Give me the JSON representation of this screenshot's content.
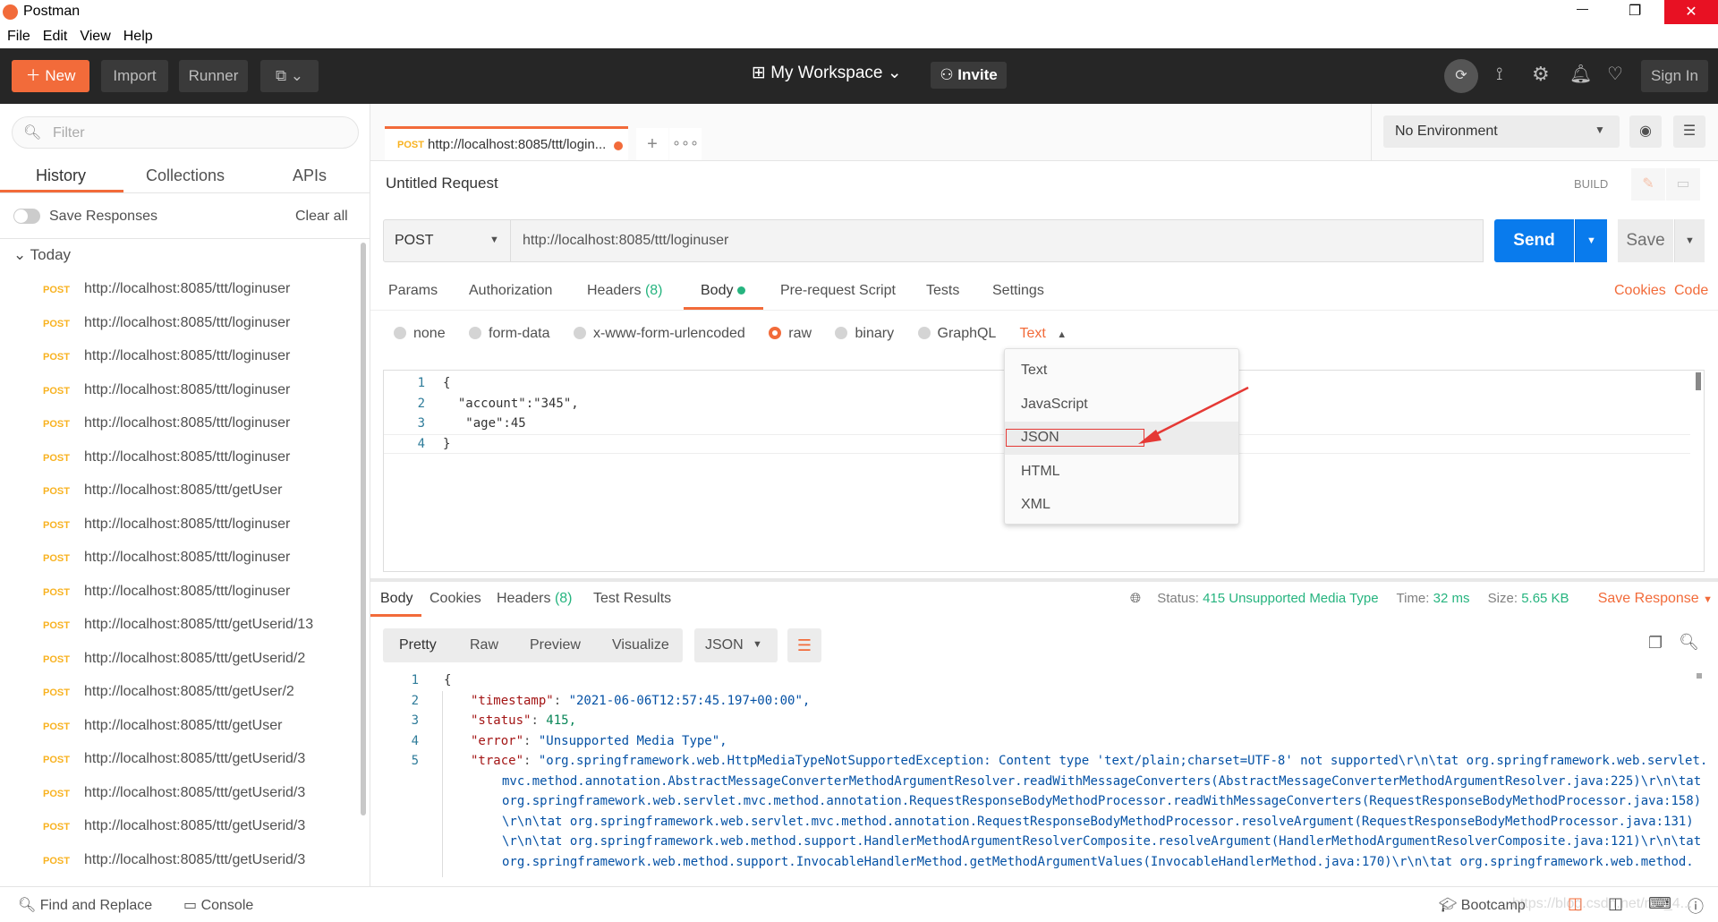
{
  "window": {
    "title": "Postman",
    "minimize": "—",
    "restore": "❐",
    "close": "✕"
  },
  "menu": [
    "File",
    "Edit",
    "View",
    "Help"
  ],
  "toolbar": {
    "new": "New",
    "import": "Import",
    "runner": "Runner",
    "workspace": "My Workspace",
    "invite": "Invite",
    "sign_in": "Sign In",
    "accent": "#f26b3a"
  },
  "sidebar": {
    "filter_placeholder": "Filter",
    "tabs": [
      "History",
      "Collections",
      "APIs"
    ],
    "save_responses": "Save Responses",
    "clear_all": "Clear all",
    "group": "Today",
    "items": [
      {
        "method": "POST",
        "url": "http://localhost:8085/ttt/loginuser"
      },
      {
        "method": "POST",
        "url": "http://localhost:8085/ttt/loginuser"
      },
      {
        "method": "POST",
        "url": "http://localhost:8085/ttt/loginuser"
      },
      {
        "method": "POST",
        "url": "http://localhost:8085/ttt/loginuser"
      },
      {
        "method": "POST",
        "url": "http://localhost:8085/ttt/loginuser"
      },
      {
        "method": "POST",
        "url": "http://localhost:8085/ttt/loginuser"
      },
      {
        "method": "POST",
        "url": "http://localhost:8085/ttt/getUser"
      },
      {
        "method": "POST",
        "url": "http://localhost:8085/ttt/loginuser"
      },
      {
        "method": "POST",
        "url": "http://localhost:8085/ttt/loginuser"
      },
      {
        "method": "POST",
        "url": "http://localhost:8085/ttt/loginuser"
      },
      {
        "method": "POST",
        "url": "http://localhost:8085/ttt/getUserid/13"
      },
      {
        "method": "POST",
        "url": "http://localhost:8085/ttt/getUserid/2"
      },
      {
        "method": "POST",
        "url": "http://localhost:8085/ttt/getUser/2"
      },
      {
        "method": "POST",
        "url": "http://localhost:8085/ttt/getUser"
      },
      {
        "method": "POST",
        "url": "http://localhost:8085/ttt/getUserid/3"
      },
      {
        "method": "POST",
        "url": "http://localhost:8085/ttt/getUserid/3"
      },
      {
        "method": "POST",
        "url": "http://localhost:8085/ttt/getUserid/3"
      },
      {
        "method": "POST",
        "url": "http://localhost:8085/ttt/getUserid/3"
      }
    ]
  },
  "request_tab": {
    "method": "POST",
    "title": "http://localhost:8085/ttt/login..."
  },
  "environment": "No Environment",
  "request": {
    "name": "Untitled Request",
    "build": "BUILD",
    "method": "POST",
    "url": "http://localhost:8085/ttt/loginuser",
    "send": "Send",
    "save": "Save",
    "tabs": [
      "Params",
      "Authorization",
      "Headers",
      "Body",
      "Pre-request Script",
      "Tests",
      "Settings"
    ],
    "headers_count": "(8)",
    "cookies": "Cookies",
    "code": "Code",
    "body_modes": [
      "none",
      "form-data",
      "x-www-form-urlencoded",
      "raw",
      "binary",
      "GraphQL"
    ],
    "selected_mode": "raw",
    "content_type": "Text",
    "body_lines": [
      "{",
      "  \"account\":\"345\",",
      "   \"age\":45",
      "}"
    ]
  },
  "type_menu": {
    "options": [
      "Text",
      "JavaScript",
      "JSON",
      "HTML",
      "XML"
    ],
    "highlighted": "JSON"
  },
  "response": {
    "tabs": [
      "Body",
      "Cookies",
      "Headers",
      "Test Results"
    ],
    "headers_count": "(8)",
    "status_label": "Status:",
    "status": "415 Unsupported Media Type",
    "time_label": "Time:",
    "time": "32 ms",
    "size_label": "Size:",
    "size": "5.65 KB",
    "save_response": "Save Response",
    "views": [
      "Pretty",
      "Raw",
      "Preview",
      "Visualize"
    ],
    "format": "JSON",
    "lines": [
      {
        "n": "1",
        "key": "",
        "val": "{"
      },
      {
        "n": "2",
        "key": "\"timestamp\"",
        "val": "\"2021-06-06T12:57:45.197+00:00\","
      },
      {
        "n": "3",
        "key": "\"status\"",
        "val": "415,"
      },
      {
        "n": "4",
        "key": "\"error\"",
        "val": "\"Unsupported Media Type\","
      },
      {
        "n": "5",
        "key": "\"trace\"",
        "val": "\"org.springframework.web.HttpMediaTypeNotSupportedException: Content type 'text/plain;charset=UTF-8' not supported\\r\\n\\tat org.springframework.web.servlet."
      }
    ],
    "trace_cont": [
      "mvc.method.annotation.AbstractMessageConverterMethodArgumentResolver.readWithMessageConverters(AbstractMessageConverterMethodArgumentResolver.java:225)\\r\\n\\tat",
      "org.springframework.web.servlet.mvc.method.annotation.RequestResponseBodyMethodProcessor.readWithMessageConverters(RequestResponseBodyMethodProcessor.java:158)",
      "\\r\\n\\tat org.springframework.web.servlet.mvc.method.annotation.RequestResponseBodyMethodProcessor.resolveArgument(RequestResponseBodyMethodProcessor.java:131)",
      "\\r\\n\\tat org.springframework.web.method.support.HandlerMethodArgumentResolverComposite.resolveArgument(HandlerMethodArgumentResolverComposite.java:121)\\r\\n\\tat",
      "org.springframework.web.method.support.InvocableHandlerMethod.getMethodArgumentValues(InvocableHandlerMethod.java:170)\\r\\n\\tat org.springframework.web.method."
    ]
  },
  "footer": {
    "find_replace": "Find and Replace",
    "console": "Console",
    "bootcamp": "Bootcamp",
    "watermark": "https://blog.csdn.net/m0_4..."
  }
}
